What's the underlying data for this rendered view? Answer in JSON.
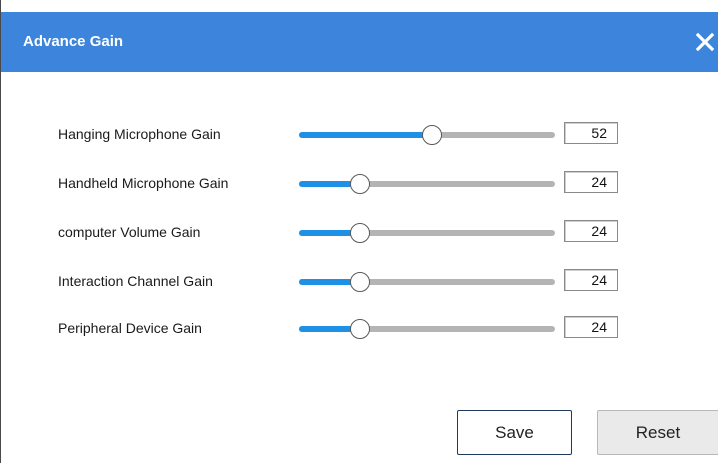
{
  "dialog": {
    "title": "Advance Gain",
    "close_icon": "close-icon"
  },
  "gains": [
    {
      "id": "hanging-microphone",
      "label": "Hanging Microphone Gain",
      "value": "52",
      "level": 0.52
    },
    {
      "id": "handheld-microphone",
      "label": "Handheld Microphone Gain",
      "value": "24",
      "level": 0.24
    },
    {
      "id": "computer-volume",
      "label": "computer Volume Gain",
      "value": "24",
      "level": 0.24
    },
    {
      "id": "interaction-channel",
      "label": "Interaction Channel Gain",
      "value": "24",
      "level": 0.24
    },
    {
      "id": "peripheral-device",
      "label": "Peripheral Device Gain",
      "value": "24",
      "level": 0.24
    }
  ],
  "buttons": {
    "save_label": "Save",
    "reset_label": "Reset"
  },
  "colors": {
    "titlebar": "#3c84dc",
    "slider_fill": "#1e90e6",
    "slider_track": "#b4b4b4"
  }
}
